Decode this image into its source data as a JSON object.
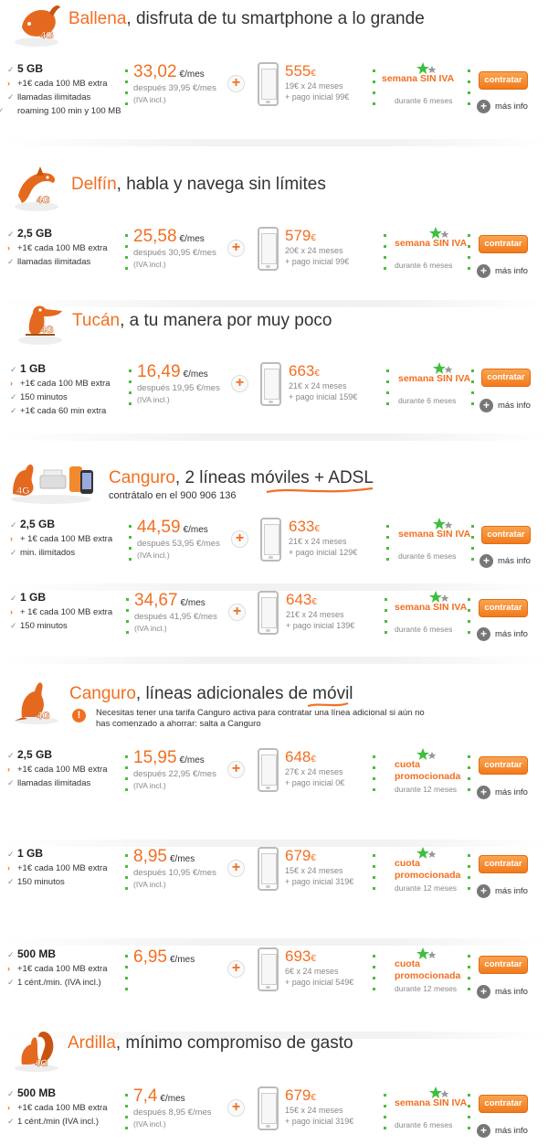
{
  "colors": {
    "accent": "#f26f21",
    "green": "#4bbd3b",
    "grey": "#888888"
  },
  "common": {
    "per_month": "€/mes",
    "iva": "(IVA incl.)",
    "cta": "contratar",
    "more": "más info"
  },
  "sections": [
    {
      "name": "Ballena",
      "tagline": ", disfruta de tu smartphone a lo grande",
      "icon": "whale-icon",
      "plans": [
        {
          "gb": "5 GB",
          "extra": "+1€ cada 100 MB extra",
          "lines": [
            "llamadas ilimitadas",
            "roaming 100 min y 100 MB"
          ],
          "price": "33,02",
          "after": "después 39,95 €/mes",
          "device_price": "555",
          "device_line1": "19€ x 24 meses",
          "device_line2": "+ pago inicial 99€",
          "promo": "semana SIN IVA",
          "promo_note": "durante 6 meses"
        }
      ]
    },
    {
      "name": "Delfín",
      "tagline": ", habla y navega sin límites",
      "icon": "dolphin-icon",
      "plans": [
        {
          "gb": "2,5 GB",
          "extra": "+1€ cada 100 MB extra",
          "lines": [
            "llamadas ilimitadas"
          ],
          "price": "25,58",
          "after": "después 30,95 €/mes",
          "device_price": "579",
          "device_line1": "20€ x 24 meses",
          "device_line2": "+ pago inicial 99€",
          "promo": "semana SIN IVA",
          "promo_note": "durante 6 meses"
        }
      ]
    },
    {
      "name": "Tucán",
      "tagline": ", a tu manera por muy poco",
      "icon": "toucan-icon",
      "plans": [
        {
          "gb": "1 GB",
          "extra": "+1€ cada 100 MB extra",
          "lines": [
            "150 minutos",
            "+1€ cada 60 min extra"
          ],
          "price": "16,49",
          "after": "después 19,95 €/mes",
          "device_price": "663",
          "device_line1": "21€ x 24 meses",
          "device_line2": "+ pago inicial 159€",
          "promo": "semana SIN IVA",
          "promo_note": "durante 6 meses"
        }
      ]
    },
    {
      "name": "Canguro",
      "tagline": ", 2 líneas móviles + ADSL",
      "sub": "contrátalo en el 900 906 136",
      "icon": "kangaroo-router-icon",
      "plans": [
        {
          "gb": "2,5 GB",
          "extra": "+ 1€ cada 100 MB extra",
          "lines": [
            "min. ilimitados"
          ],
          "price": "44,59",
          "after": "después 53,95 €/mes",
          "device_price": "633",
          "device_line1": "21€ x 24 meses",
          "device_line2": "+ pago inicial 129€",
          "promo": "semana SIN IVA",
          "promo_note": "durante 6 meses"
        },
        {
          "gb": "1 GB",
          "extra": "+ 1€ cada 100 MB extra",
          "lines": [
            "150 minutos"
          ],
          "price": "34,67",
          "after": "después 41,95 €/mes",
          "device_price": "643",
          "device_line1": "21€ x 24 meses",
          "device_line2": "+ pago inicial 139€",
          "promo": "semana SIN IVA",
          "promo_note": "durante 6 meses"
        }
      ]
    },
    {
      "name": "Canguro",
      "tagline": ", líneas adicionales de móvil",
      "notice": "Necesitas tener una tarifa Canguro activa para contratar una línea adicional si aún no has comenzado a ahorrar: salta a Canguro",
      "icon": "kangaroo-icon",
      "plans": [
        {
          "gb": "2,5 GB",
          "extra": "+1€ cada 100 MB extra",
          "lines": [
            "llamadas ilimitadas"
          ],
          "price": "15,95",
          "after": "después 22,95 €/mes",
          "device_price": "648",
          "device_line1": "27€ x 24 meses",
          "device_line2": "+ pago inicial 0€",
          "promo": "cuota promocionada",
          "promo_note": "durante 12 meses"
        },
        {
          "gb": "1 GB",
          "extra": "+1€ cada 100 MB extra",
          "lines": [
            "150 minutos"
          ],
          "price": "8,95",
          "after": "después 10,95 €/mes",
          "device_price": "679",
          "device_line1": "15€ x 24 meses",
          "device_line2": "+ pago inicial 319€",
          "promo": "cuota promocionada",
          "promo_note": "durante 12 meses"
        },
        {
          "gb": "500 MB",
          "extra": "+1€ cada 100 MB extra",
          "lines": [
            "1 cént./min. (IVA incl.)"
          ],
          "price": "6,95",
          "after": "",
          "device_price": "693",
          "device_line1": "6€ x 24 meses",
          "device_line2": "+ pago inicial 549€",
          "promo": "cuota promocionada",
          "promo_note": "durante 12 meses"
        }
      ]
    },
    {
      "name": "Ardilla",
      "tagline": ", mínimo compromiso de gasto",
      "icon": "squirrel-icon",
      "plans": [
        {
          "gb": "500 MB",
          "extra": "+1€ cada 100 MB extra",
          "lines": [
            "1 cént./min (IVA incl.)"
          ],
          "price": "7,4",
          "after": "después 8,95 €/mes",
          "device_price": "679",
          "device_line1": "15€ x 24 meses",
          "device_line2": "+ pago inicial 319€",
          "promo": "semana SIN IVA",
          "promo_note": "durante 6 meses"
        }
      ]
    }
  ]
}
